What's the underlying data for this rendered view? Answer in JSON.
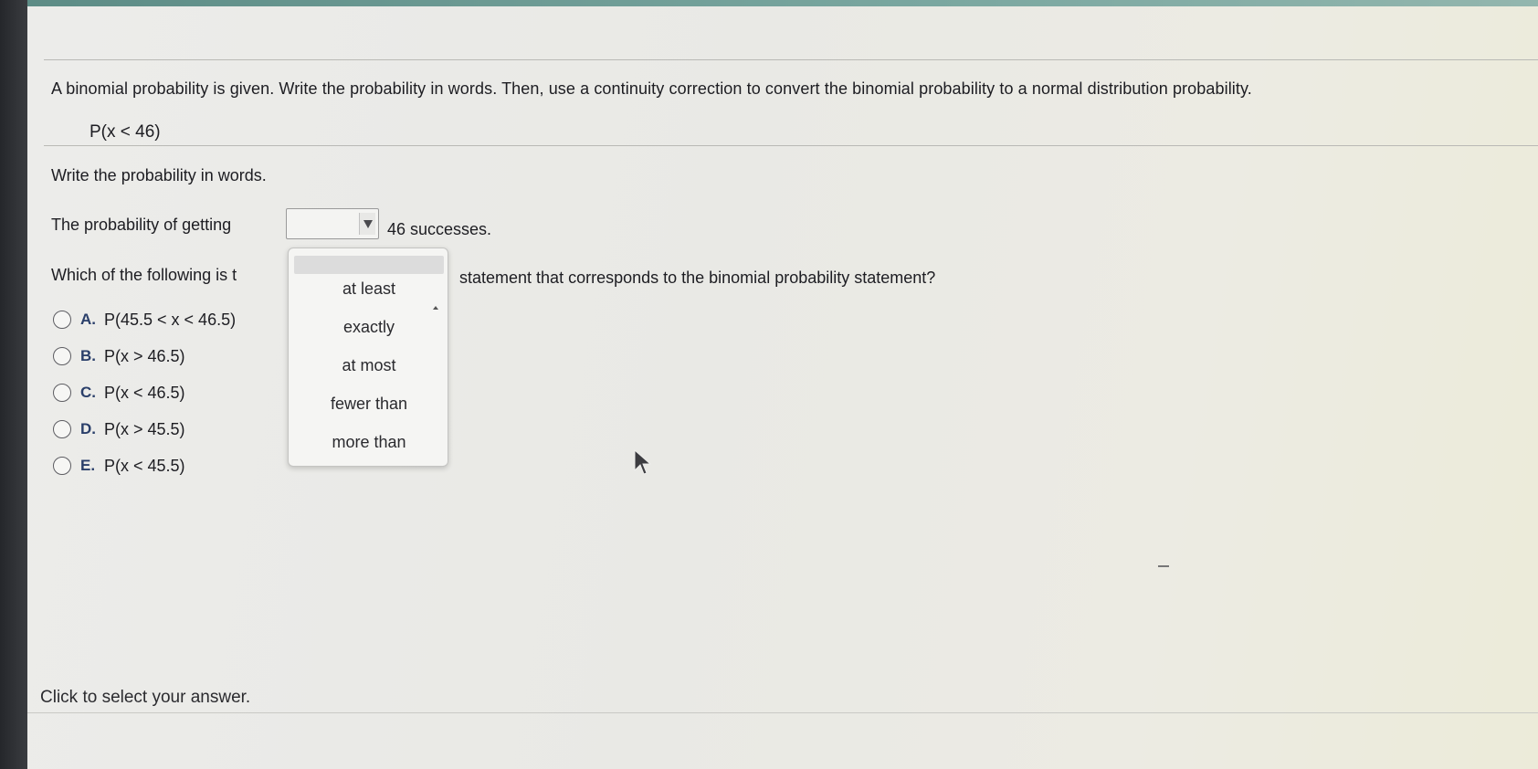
{
  "question": {
    "intro": "A binomial probability is given. Write the probability in words. Then, use a continuity correction to convert the binomial probability to a normal distribution probability.",
    "expression": "P(x < 46)"
  },
  "part1": {
    "heading": "Write the probability in words.",
    "sentence_prefix": "The probability of getting",
    "sentence_suffix": "46 successes.",
    "selected_value": ""
  },
  "dropdown": {
    "options": [
      "at least",
      "exactly",
      "at most",
      "fewer than",
      "more than"
    ]
  },
  "part2": {
    "question_prefix": "Which of the following is t",
    "question_suffix": "statement that corresponds to the binomial probability statement?",
    "choices": [
      {
        "letter": "A.",
        "text": "P(45.5 < x < 46.5)"
      },
      {
        "letter": "B.",
        "text": "P(x > 46.5)"
      },
      {
        "letter": "C.",
        "text": "P(x < 46.5)"
      },
      {
        "letter": "D.",
        "text": "P(x > 45.5)"
      },
      {
        "letter": "E.",
        "text": "P(x < 45.5)"
      }
    ]
  },
  "footer": {
    "hint": "Click to select your answer."
  },
  "colors": {
    "accent_strip": "#7aa7a0",
    "choice_letter": "#2a3f6a"
  }
}
